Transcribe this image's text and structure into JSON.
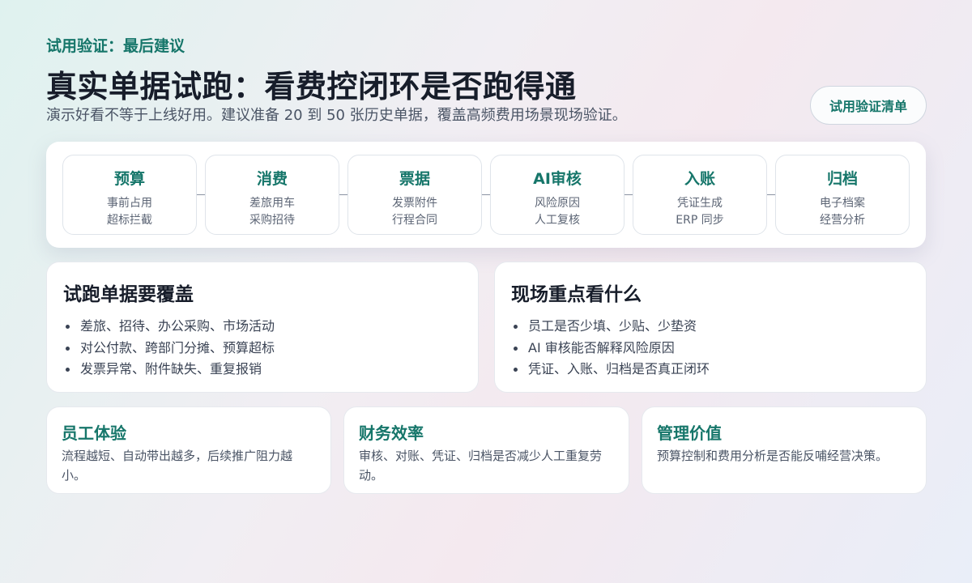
{
  "header": {
    "eyebrow": "试用验证：最后建议",
    "title": "真实单据试跑：看费控闭环是否跑得通",
    "subtitle": "演示好看不等于上线好用。建议准备 20 到 50 张历史单据，覆盖高频费用场景现场验证。",
    "checklist_button": "试用验证清单"
  },
  "flow": {
    "steps": [
      {
        "name": "预算",
        "line1": "事前占用",
        "line2": "超标拦截"
      },
      {
        "name": "消费",
        "line1": "差旅用车",
        "line2": "采购招待"
      },
      {
        "name": "票据",
        "line1": "发票附件",
        "line2": "行程合同"
      },
      {
        "name": "AI审核",
        "line1": "风险原因",
        "line2": "人工复核"
      },
      {
        "name": "入账",
        "line1": "凭证生成",
        "line2": "ERP 同步"
      },
      {
        "name": "归档",
        "line1": "电子档案",
        "line2": "经营分析"
      }
    ]
  },
  "coverage": {
    "title": "试跑单据要覆盖",
    "items": [
      "差旅、招待、办公采购、市场活动",
      "对公付款、跨部门分摊、预算超标",
      "发票异常、附件缺失、重复报销"
    ]
  },
  "focus": {
    "title": "现场重点看什么",
    "items": [
      "员工是否少填、少贴、少垫资",
      "AI 审核能否解释风险原因",
      "凭证、入账、归档是否真正闭环"
    ]
  },
  "values": [
    {
      "title": "员工体验",
      "text": "流程越短、自动带出越多，后续推广阻力越小。"
    },
    {
      "title": "财务效率",
      "text": "审核、对账、凭证、归档是否减少人工重复劳动。"
    },
    {
      "title": "管理价值",
      "text": "预算控制和费用分析是否能反哺经营决策。"
    }
  ],
  "colors": {
    "accent": "#16766a",
    "title": "#171d2a"
  }
}
